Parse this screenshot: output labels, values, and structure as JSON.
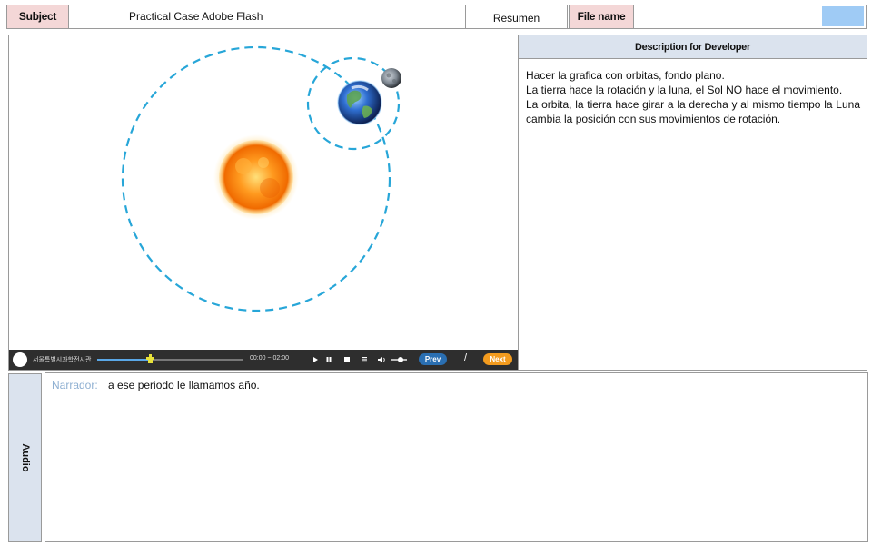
{
  "header": {
    "subject_label": "Subject",
    "subject_value": "Practical Case Adobe Flash",
    "resumen_label": "Resumen",
    "file_name_label": "File name",
    "file_swatch_color": "#9fcbf5"
  },
  "stage": {
    "orbit_color": "#27a6d8",
    "sun_icon": "sun-icon",
    "earth_icon": "earth-icon",
    "moon_icon": "moon-icon"
  },
  "player": {
    "org_name": "서울특별시과학전시관",
    "time": "00:00 ~ 02:00",
    "progress": 0.36,
    "prev_label": "Prev",
    "separator": "/",
    "next_label": "Next",
    "play_icon": "play-icon",
    "pause_icon": "pause-icon",
    "stop_icon": "stop-icon",
    "menu_icon": "menu-icon",
    "volume_icon": "volume-icon"
  },
  "description": {
    "title": "Description for Developer",
    "lines": [
      "Hacer la grafica con orbitas, fondo plano.",
      "La tierra hace la rotación y la luna, el Sol NO hace el movimiento.",
      "La orbita,  la tierra hace girar a la derecha  y al mismo tiempo la Luna cambia la posición con sus movimientos de rotación."
    ]
  },
  "audio": {
    "side_label": "Audio",
    "narrator_label": "Narrador:",
    "narrator_text": "a ese periodo le llamamos año."
  }
}
